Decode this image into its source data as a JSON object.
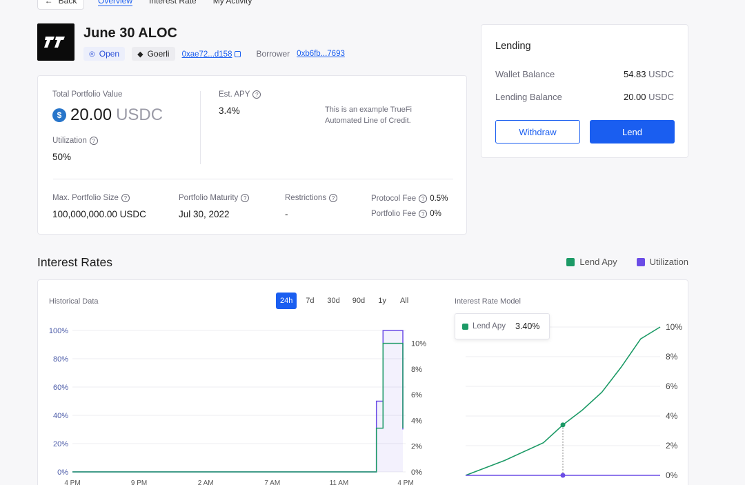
{
  "nav": {
    "back_label": "Back",
    "tabs": [
      "Overview",
      "Interest Rate",
      "My Activity"
    ]
  },
  "header": {
    "title": "June 30 ALOC",
    "status": "Open",
    "network": "Goerli",
    "address": "0xae72...d158",
    "borrower_label": "Borrower",
    "borrower_address": "0xb6fb...7693"
  },
  "portfolio": {
    "total_label": "Total Portfolio Value",
    "total_value": "20.00",
    "total_unit": "USDC",
    "est_apy_label": "Est. APY",
    "est_apy_value": "3.4%",
    "note": "This is an example TrueFi Automated Line of Credit.",
    "utilization_label": "Utilization",
    "utilization_value": "50%",
    "max_size_label": "Max. Portfolio Size",
    "max_size_value": "100,000,000.00 USDC",
    "maturity_label": "Portfolio Maturity",
    "maturity_value": "Jul 30, 2022",
    "restrictions_label": "Restrictions",
    "restrictions_value": "-",
    "protocol_fee_label": "Protocol Fee",
    "protocol_fee_value": "0.5%",
    "portfolio_fee_label": "Portfolio Fee",
    "portfolio_fee_value": "0%"
  },
  "lending": {
    "title": "Lending",
    "wallet_label": "Wallet Balance",
    "wallet_value": "54.83",
    "wallet_unit": "USDC",
    "lending_label": "Lending Balance",
    "lending_value": "20.00",
    "lending_unit": "USDC",
    "withdraw_label": "Withdraw",
    "lend_label": "Lend"
  },
  "interest": {
    "title": "Interest Rates",
    "legend": [
      {
        "name": "Lend Apy",
        "color": "#1c9a66"
      },
      {
        "name": "Utilization",
        "color": "#6b4ce6"
      }
    ],
    "historical_label": "Historical Data",
    "ranges": [
      "24h",
      "7d",
      "30d",
      "90d",
      "1y",
      "All"
    ],
    "active_range": "24h",
    "model_label": "Interest Rate Model",
    "tooltip_label": "Lend Apy",
    "tooltip_value": "3.40%"
  },
  "chart_data": [
    {
      "type": "line",
      "title": "Historical Data",
      "x": [
        "4 PM",
        "9 PM",
        "2 AM",
        "7 AM",
        "11 AM",
        "4 PM"
      ],
      "left_axis_ticks": [
        "0%",
        "20%",
        "40%",
        "60%",
        "80%",
        "100%"
      ],
      "right_axis_ticks": [
        "0%",
        "2%",
        "4%",
        "6%",
        "8%",
        "10%"
      ],
      "left_ylim": [
        0,
        100
      ],
      "right_ylim": [
        0,
        11
      ],
      "series": [
        {
          "name": "Utilization",
          "color": "#6b4ce6",
          "axis": "left",
          "points": [
            [
              0,
              0
            ],
            [
              0.92,
              0
            ],
            [
              0.92,
              50
            ],
            [
              0.94,
              50
            ],
            [
              0.94,
              100
            ],
            [
              1.0,
              100
            ],
            [
              1.0,
              30
            ]
          ]
        },
        {
          "name": "Lend Apy",
          "color": "#1c9a66",
          "axis": "right",
          "points": [
            [
              0,
              0
            ],
            [
              0.92,
              0
            ],
            [
              0.92,
              3.4
            ],
            [
              0.94,
              3.4
            ],
            [
              0.94,
              10
            ],
            [
              1.0,
              10
            ],
            [
              1.0,
              3.4
            ]
          ]
        }
      ]
    },
    {
      "type": "line",
      "title": "Interest Rate Model",
      "right_axis_ticks": [
        "0%",
        "2%",
        "4%",
        "6%",
        "8%",
        "10%"
      ],
      "ylim": [
        0,
        10
      ],
      "series": [
        {
          "name": "Lend Apy",
          "color": "#1c9a66",
          "points": [
            [
              0,
              0
            ],
            [
              0.2,
              1.0
            ],
            [
              0.4,
              2.2
            ],
            [
              0.5,
              3.4
            ],
            [
              0.6,
              4.4
            ],
            [
              0.7,
              5.6
            ],
            [
              0.8,
              7.3
            ],
            [
              0.9,
              9.2
            ],
            [
              1.0,
              10
            ]
          ]
        },
        {
          "name": "Utilization",
          "color": "#6b4ce6",
          "points": [
            [
              0,
              0
            ],
            [
              1.0,
              0
            ]
          ]
        }
      ],
      "marker": {
        "x": 0.5,
        "y": 3.4
      }
    }
  ]
}
